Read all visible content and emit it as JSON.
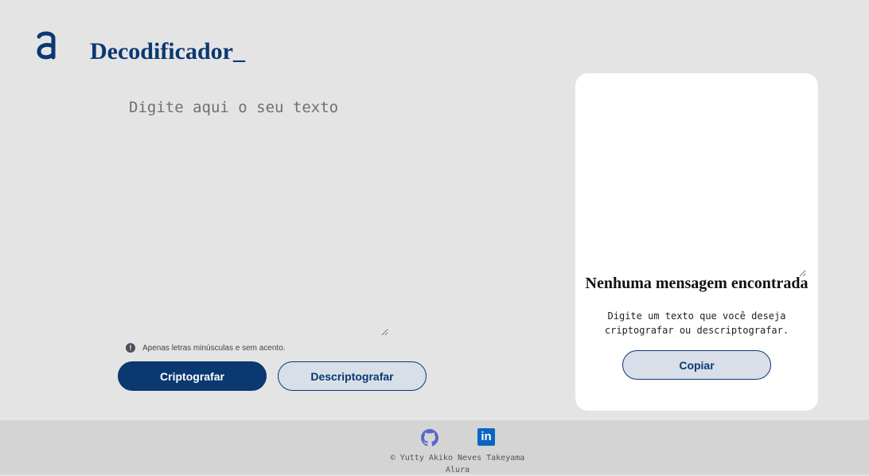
{
  "header": {
    "logo_icon": "alura-logo-icon",
    "title": "Decodificador_"
  },
  "input": {
    "placeholder": "Digite aqui o seu texto",
    "value": ""
  },
  "hint": {
    "icon": "info-icon",
    "text": "Apenas letras minúsculas e sem acento."
  },
  "buttons": {
    "encrypt_label": "Criptografar",
    "decrypt_label": "Descriptografar"
  },
  "output_panel": {
    "heading": "Nenhuma mensagem encontrada",
    "text": "Digite um texto que você deseja criptografar ou descriptografar.",
    "copy_label": "Copiar"
  },
  "footer": {
    "github_icon": "github-icon",
    "linkedin_icon": "linkedin-icon",
    "linkedin_text": "in",
    "copyright_line1": "© Yutty Akiko Neves Takeyama",
    "copyright_line2": "Alura"
  },
  "colors": {
    "primary": "#0a3871",
    "secondary_button": "#d8dfe8",
    "background": "#e4e4e5",
    "footer": "#d4d4d4",
    "linkedin": "#0a66c2",
    "github": "#5b66c9"
  }
}
